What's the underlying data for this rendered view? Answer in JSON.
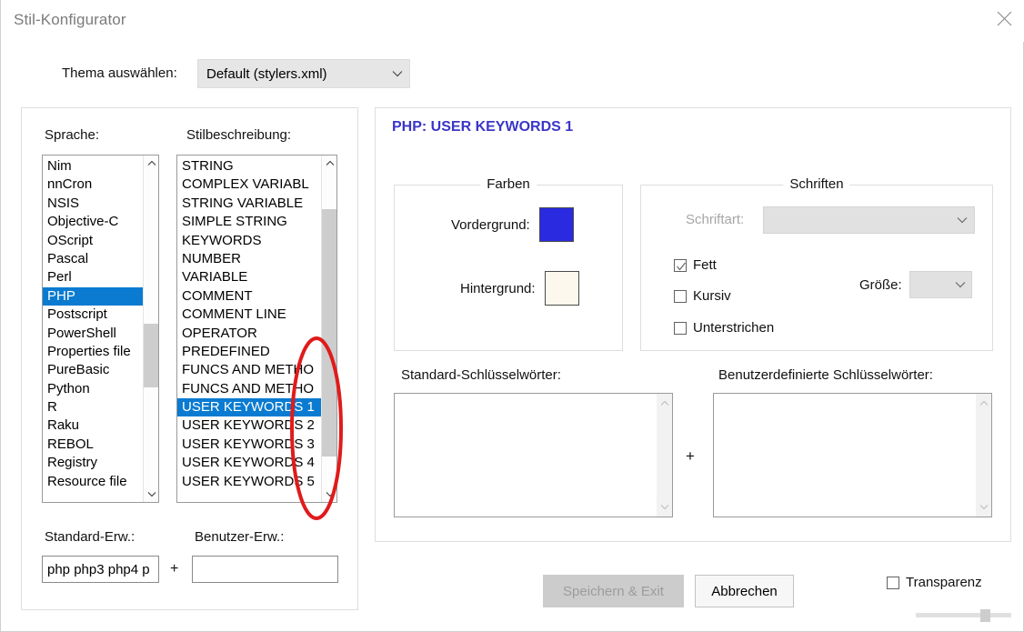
{
  "window": {
    "title": "Stil-Konfigurator",
    "close_icon": "close-icon"
  },
  "theme": {
    "label": "Thema auswählen:",
    "selected": "Default (stylers.xml)",
    "chevron_icon": "chevron-down-icon"
  },
  "left_panel": {
    "language_label": "Sprache:",
    "style_label": "Stilbeschreibung:",
    "languages": [
      "Nim",
      "nnCron",
      "NSIS",
      "Objective-C",
      "OScript",
      "Pascal",
      "Perl",
      "PHP",
      "Postscript",
      "PowerShell",
      "Properties file",
      "PureBasic",
      "Python",
      "R",
      "Raku",
      "REBOL",
      "Registry",
      "Resource file"
    ],
    "language_selected": "PHP",
    "styles": [
      "STRING",
      "COMPLEX VARIABL",
      "STRING VARIABLE",
      "SIMPLE STRING",
      "KEYWORDS",
      "NUMBER",
      "VARIABLE",
      "COMMENT",
      "COMMENT LINE",
      "OPERATOR",
      "PREDEFINED",
      "FUNCS AND METHO",
      "FUNCS AND METHO",
      "USER KEYWORDS 1",
      "USER KEYWORDS 2",
      "USER KEYWORDS 3",
      "USER KEYWORDS 4",
      "USER KEYWORDS 5"
    ],
    "style_selected": "USER KEYWORDS 1",
    "std_ext_label": "Standard-Erw.:",
    "user_ext_label": "Benutzer-Erw.:",
    "std_ext_value": "php php3 php4 p",
    "user_ext_value": "",
    "user_ext_placeholder": "",
    "plus_sign": "+"
  },
  "right_panel": {
    "heading": "PHP: USER KEYWORDS 1",
    "colors": {
      "legend": "Farben",
      "foreground_label": "Vordergrund:",
      "foreground_color": "#2a2ae0",
      "background_label": "Hintergrund:",
      "background_color": "#fdf8ee"
    },
    "fonts": {
      "legend": "Schriften",
      "fontname_label": "Schriftart:",
      "fontname_value": "",
      "size_label": "Größe:",
      "size_value": "",
      "bold_label": "Fett",
      "bold_checked": true,
      "italic_label": "Kursiv",
      "italic_checked": false,
      "underline_label": "Unterstrichen",
      "underline_checked": false,
      "chevron_icon": "chevron-down-icon"
    },
    "keywords": {
      "std_label": "Standard-Schlüsselwörter:",
      "std_value": "",
      "user_label": "Benutzerdefinierte Schlüsselwörter:",
      "user_value": "",
      "plus_sign": "+"
    }
  },
  "footer": {
    "save_label": "Speichern & Exit",
    "cancel_label": "Abbrechen",
    "transparency_label": "Transparenz",
    "transparency_checked": false,
    "slider_position_percent": 75
  },
  "annotation": {
    "shape": "ellipse",
    "color": "#e01b1b"
  }
}
